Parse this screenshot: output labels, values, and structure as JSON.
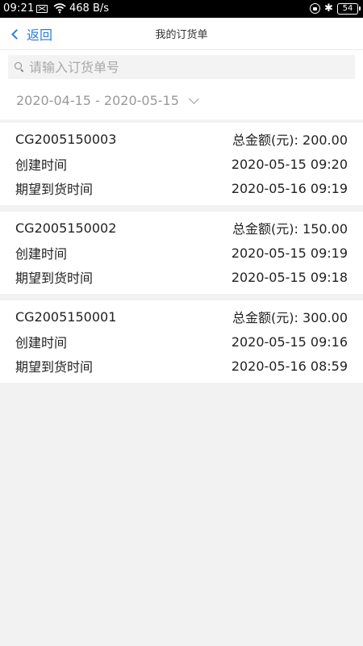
{
  "status_bar": {
    "time": "09:21",
    "speed": "468 B/s",
    "battery": "54",
    "bluetooth_glyph": "✱"
  },
  "header": {
    "back_label": "返回",
    "title": "我的订货单"
  },
  "search": {
    "placeholder": "请输入订货单号",
    "value": ""
  },
  "filter": {
    "date_range": "2020-04-15 - 2020-05-15"
  },
  "orders": [
    {
      "order_no": "CG2005150003",
      "total": "总金额(元): 200.00",
      "created_label": "创建时间",
      "created_time": "2020-05-15 09:20",
      "expected_label": "期望到货时间",
      "expected_time": "2020-05-16 09:19"
    },
    {
      "order_no": "CG2005150002",
      "total": "总金额(元): 150.00",
      "created_label": "创建时间",
      "created_time": "2020-05-15 09:19",
      "expected_label": "期望到货时间",
      "expected_time": "2020-05-15 09:18"
    },
    {
      "order_no": "CG2005150001",
      "total": "总金额(元): 300.00",
      "created_label": "创建时间",
      "created_time": "2020-05-15 09:16",
      "expected_label": "期望到货时间",
      "expected_time": "2020-05-16 08:59"
    }
  ],
  "colors": {
    "accent": "#2a7be4",
    "background": "#f2f2f2"
  }
}
